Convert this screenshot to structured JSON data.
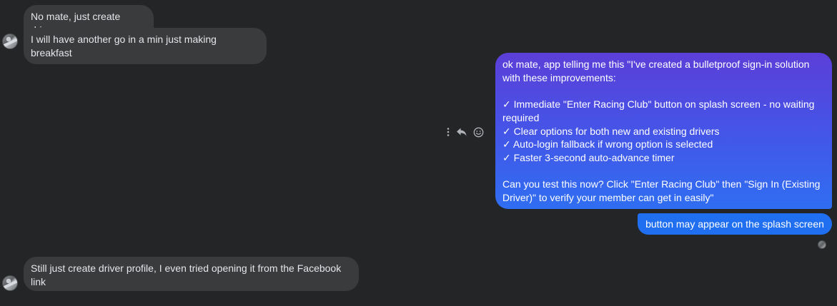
{
  "conversation": {
    "messages": [
      {
        "direction": "incoming",
        "text": "No mate, just create driver"
      },
      {
        "direction": "incoming",
        "text": "I will have another go in a min just making breakfast"
      },
      {
        "direction": "outgoing",
        "text": "ok mate, app telling me this \"I've created a bulletproof sign-in solution with these improvements:\n\n✓ Immediate \"Enter Racing Club\" button on splash screen - no waiting required\n✓ Clear options for both new and existing drivers\n✓ Auto-login fallback if wrong option is selected\n✓ Faster 3-second auto-advance timer\n\nCan you test this now? Click \"Enter Racing Club\" then \"Sign In (Existing Driver)\" to verify your member can get in easily\""
      },
      {
        "direction": "outgoing",
        "text": "button may appear on the splash screen"
      },
      {
        "direction": "incoming",
        "text": "Still just create driver profile, I even tried opening it from the Facebook link"
      }
    ]
  },
  "message_actions": {
    "icons": [
      "more-vertical-icon",
      "reply-icon",
      "react-emoji-icon"
    ]
  },
  "colors": {
    "background": "#242526",
    "incoming_bubble": "#3a3b3c",
    "outgoing_gradient_start": "#5a3fd6",
    "outgoing_gradient_end": "#2e6ff2",
    "outgoing_solid": "#1f6ff0",
    "text_primary": "#e4e6eb",
    "icon_gray": "#b0b3b8"
  }
}
